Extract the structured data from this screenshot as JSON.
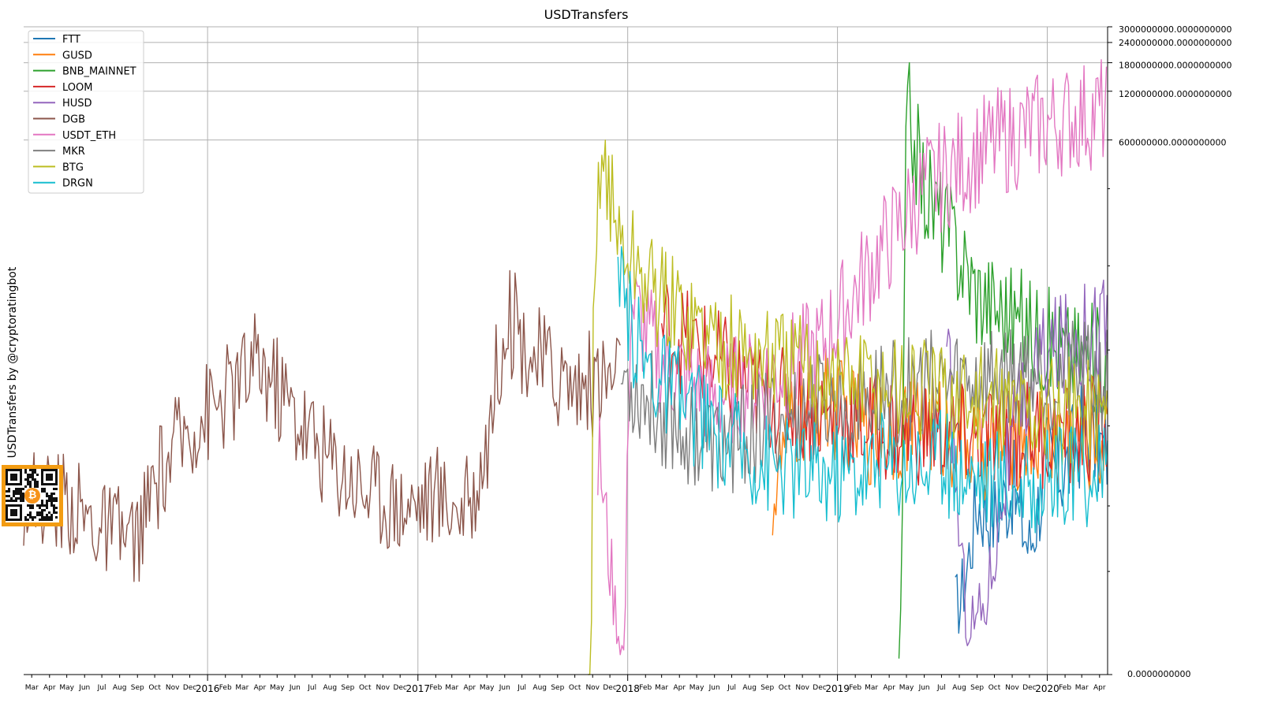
{
  "chart_data": {
    "type": "line",
    "title": "USDTransfers",
    "ylabel": "USDTransfers by @cryptoratingbot",
    "xlabel": "",
    "y_scale": "symlog",
    "x_range": [
      "2015-02-15",
      "2020-04-15"
    ],
    "grid": true,
    "legend_position": "top-left",
    "y_right_tick_labels": [
      "3000000000.0000000000",
      "2400000000.0000000000",
      "1800000000.0000000000",
      "1200000000.0000000000",
      "600000000.0000000000",
      "0.0000000000"
    ],
    "y_right_tick_values": [
      3000000000,
      2400000000,
      1800000000,
      1200000000,
      600000000,
      0
    ],
    "year_labels": [
      "2016",
      "2017",
      "2018",
      "2019",
      "2020"
    ],
    "month_labels": [
      "Mar",
      "Apr",
      "May",
      "Jun",
      "Jul",
      "Aug",
      "Sep",
      "Oct",
      "Nov",
      "Dec",
      "Feb",
      "Mar",
      "Apr",
      "May",
      "Jun",
      "Jul",
      "Aug",
      "Sep",
      "Oct",
      "Nov",
      "Dec",
      "Feb",
      "Mar",
      "Apr",
      "May",
      "Jun",
      "Jul",
      "Aug",
      "Sep",
      "Oct",
      "Nov",
      "Dec",
      "Feb",
      "Mar",
      "Apr",
      "May",
      "Jun",
      "Jul",
      "Aug",
      "Sep",
      "Oct",
      "Nov",
      "Dec",
      "Feb",
      "Mar",
      "Apr",
      "May",
      "Jun",
      "Jul",
      "Aug",
      "Sep",
      "Oct",
      "Nov",
      "Dec",
      "Feb",
      "Mar",
      "Apr"
    ],
    "series": [
      {
        "name": "FTT",
        "color": "#1f77b4",
        "start": "2019-07-25",
        "end": "2020-04-15",
        "points": [
          [
            "2019-08-01",
            480000
          ],
          [
            "2019-09-01",
            3200000
          ],
          [
            "2019-10-01",
            2500000
          ],
          [
            "2019-11-01",
            4000000
          ],
          [
            "2019-12-01",
            1500000
          ],
          [
            "2020-01-01",
            6000000
          ],
          [
            "2020-02-01",
            5000000
          ],
          [
            "2020-03-01",
            9000000
          ],
          [
            "2020-04-01",
            7000000
          ]
        ]
      },
      {
        "name": "GUSD",
        "color": "#ff7f0e",
        "start": "2018-09-10",
        "end": "2020-04-15",
        "points": [
          [
            "2018-09-15",
            3500000
          ],
          [
            "2018-10-01",
            8000000
          ],
          [
            "2018-12-01",
            15000000
          ],
          [
            "2019-03-01",
            9000000
          ],
          [
            "2019-06-01",
            11000000
          ],
          [
            "2019-09-01",
            7000000
          ],
          [
            "2019-12-01",
            9000000
          ],
          [
            "2020-03-01",
            8000000
          ],
          [
            "2020-04-10",
            7500000
          ]
        ]
      },
      {
        "name": "BNB_MAINNET",
        "color": "#2ca02c",
        "start": "2019-04-18",
        "end": "2020-04-15",
        "points": [
          [
            "2019-04-20",
            100000
          ],
          [
            "2019-05-01",
            1000000000
          ],
          [
            "2019-06-01",
            300000000
          ],
          [
            "2019-07-01",
            200000000
          ],
          [
            "2019-09-01",
            70000000
          ],
          [
            "2019-12-01",
            40000000
          ],
          [
            "2020-02-01",
            30000000
          ],
          [
            "2020-04-10",
            25000000
          ]
        ]
      },
      {
        "name": "LOOM",
        "color": "#d62728",
        "start": "2018-03-01",
        "end": "2020-04-15",
        "points": [
          [
            "2018-03-15",
            40000000
          ],
          [
            "2018-06-01",
            25000000
          ],
          [
            "2018-09-01",
            15000000
          ],
          [
            "2018-12-01",
            12000000
          ],
          [
            "2019-03-01",
            10000000
          ],
          [
            "2019-06-01",
            9000000
          ],
          [
            "2019-09-01",
            8000000
          ],
          [
            "2019-12-01",
            9000000
          ],
          [
            "2020-02-01",
            8000000
          ],
          [
            "2020-04-10",
            10000000
          ]
        ]
      },
      {
        "name": "HUSD",
        "color": "#9467bd",
        "start": "2019-07-10",
        "end": "2020-04-15",
        "points": [
          [
            "2019-07-15",
            20000000
          ],
          [
            "2019-08-15",
            300000
          ],
          [
            "2019-09-15",
            500000
          ],
          [
            "2019-10-15",
            4000000
          ],
          [
            "2019-11-15",
            12000000
          ],
          [
            "2019-12-15",
            25000000
          ],
          [
            "2020-01-15",
            30000000
          ],
          [
            "2020-02-15",
            35000000
          ],
          [
            "2020-03-15",
            40000000
          ],
          [
            "2020-04-10",
            45000000
          ]
        ]
      },
      {
        "name": "DGB",
        "color": "#8c564b",
        "start": "2015-02-15",
        "end": "2017-12-20",
        "points": [
          [
            "2015-03-01",
            3500000
          ],
          [
            "2015-05-01",
            3200000
          ],
          [
            "2015-07-01",
            2000000
          ],
          [
            "2015-09-01",
            1700000
          ],
          [
            "2015-10-01",
            4000000
          ],
          [
            "2015-12-01",
            10000000
          ],
          [
            "2016-02-01",
            15000000
          ],
          [
            "2016-04-01",
            25000000
          ],
          [
            "2016-06-01",
            12000000
          ],
          [
            "2016-08-01",
            6000000
          ],
          [
            "2016-10-01",
            4000000
          ],
          [
            "2016-12-01",
            3000000
          ],
          [
            "2017-02-01",
            3500000
          ],
          [
            "2017-04-01",
            2800000
          ],
          [
            "2017-05-01",
            8000000
          ],
          [
            "2017-06-01",
            50000000
          ],
          [
            "2017-08-01",
            25000000
          ],
          [
            "2017-10-01",
            18000000
          ],
          [
            "2017-12-01",
            20000000
          ]
        ]
      },
      {
        "name": "USDT_ETH",
        "color": "#e377c2",
        "start": "2017-11-10",
        "end": "2020-04-15",
        "points": [
          [
            "2017-11-15",
            5500000
          ],
          [
            "2017-12-25",
            100000
          ],
          [
            "2018-01-05",
            60000000
          ],
          [
            "2018-03-01",
            25000000
          ],
          [
            "2018-06-01",
            15000000
          ],
          [
            "2018-09-01",
            20000000
          ],
          [
            "2018-12-01",
            30000000
          ],
          [
            "2019-03-01",
            100000000
          ],
          [
            "2019-06-01",
            300000000
          ],
          [
            "2019-09-01",
            500000000
          ],
          [
            "2019-12-01",
            700000000
          ],
          [
            "2020-02-01",
            800000000
          ],
          [
            "2020-04-10",
            900000000
          ]
        ]
      },
      {
        "name": "MKR",
        "color": "#7f7f7f",
        "start": "2017-12-20",
        "end": "2020-04-15",
        "points": [
          [
            "2017-12-25",
            20000000
          ],
          [
            "2018-03-01",
            12000000
          ],
          [
            "2018-06-01",
            7000000
          ],
          [
            "2018-09-01",
            10000000
          ],
          [
            "2018-12-01",
            13000000
          ],
          [
            "2019-03-01",
            15000000
          ],
          [
            "2019-06-01",
            18000000
          ],
          [
            "2019-09-01",
            20000000
          ],
          [
            "2019-12-01",
            22000000
          ],
          [
            "2020-03-01",
            20000000
          ]
        ]
      },
      {
        "name": "BTG",
        "color": "#bcbd22",
        "start": "2017-10-24",
        "end": "2020-04-15",
        "points": [
          [
            "2017-10-25",
            0
          ],
          [
            "2017-11-01",
            30000000
          ],
          [
            "2017-11-15",
            600000000
          ],
          [
            "2017-12-15",
            150000000
          ],
          [
            "2018-02-01",
            80000000
          ],
          [
            "2018-04-01",
            50000000
          ],
          [
            "2018-07-01",
            30000000
          ],
          [
            "2018-10-01",
            25000000
          ],
          [
            "2019-01-01",
            20000000
          ],
          [
            "2019-04-01",
            18000000
          ],
          [
            "2019-07-01",
            15000000
          ],
          [
            "2019-10-01",
            14000000
          ],
          [
            "2020-01-01",
            12000000
          ],
          [
            "2020-04-10",
            13000000
          ]
        ]
      },
      {
        "name": "DRGN",
        "color": "#17becf",
        "start": "2017-12-15",
        "end": "2020-04-15",
        "points": [
          [
            "2017-12-20",
            60000000
          ],
          [
            "2018-02-01",
            25000000
          ],
          [
            "2018-04-01",
            15000000
          ],
          [
            "2018-06-01",
            9000000
          ],
          [
            "2018-09-01",
            6000000
          ],
          [
            "2018-12-01",
            5000000
          ],
          [
            "2019-03-01",
            5500000
          ],
          [
            "2019-06-01",
            6000000
          ],
          [
            "2019-09-01",
            5000000
          ],
          [
            "2019-12-01",
            4000000
          ],
          [
            "2020-02-01",
            4500000
          ],
          [
            "2020-04-10",
            5000000
          ]
        ]
      }
    ]
  }
}
